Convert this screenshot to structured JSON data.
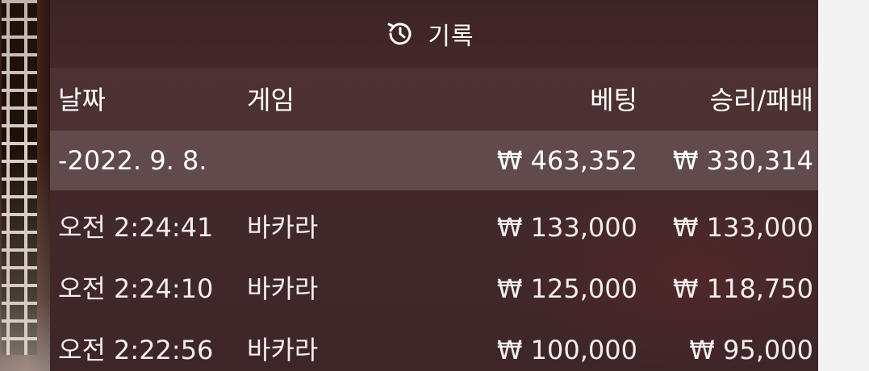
{
  "panel": {
    "title": "기록",
    "icon": "history-icon"
  },
  "columns": {
    "date": "날짜",
    "game": "게임",
    "bet": "베팅",
    "win_loss": "승리/패배"
  },
  "summary": {
    "date": "-2022. 9. 8.",
    "bet": "₩ 463,352",
    "win_loss": "₩ 330,314"
  },
  "rows": [
    {
      "time": "오전 2:24:41",
      "game": "바카라",
      "bet": "₩ 133,000",
      "win_loss": "₩ 133,000"
    },
    {
      "time": "오전 2:24:10",
      "game": "바카라",
      "bet": "₩ 125,000",
      "win_loss": "₩ 118,750"
    },
    {
      "time": "오전 2:22:56",
      "game": "바카라",
      "bet": "₩ 100,000",
      "win_loss": "₩ 95,000"
    }
  ],
  "colors": {
    "panel_bg": "#42282a",
    "summary_bg": "#5e4a4a",
    "text": "#ffffff"
  }
}
